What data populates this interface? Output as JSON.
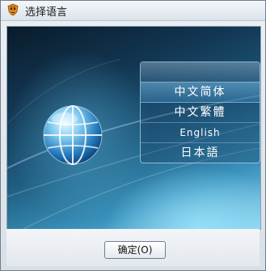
{
  "window": {
    "title": "选择语言",
    "icon": "tiger-shield-icon"
  },
  "languages": {
    "items": [
      {
        "label": "中文简体",
        "selected": true
      },
      {
        "label": "中文繁體",
        "selected": false
      },
      {
        "label": "English",
        "selected": false
      },
      {
        "label": "日本語",
        "selected": false
      }
    ]
  },
  "footer": {
    "ok_label": "确定(O)"
  },
  "colors": {
    "panel_border": "#bee1f5",
    "background_dark": "#0a1b2b",
    "background_light": "#8fd3ef"
  }
}
